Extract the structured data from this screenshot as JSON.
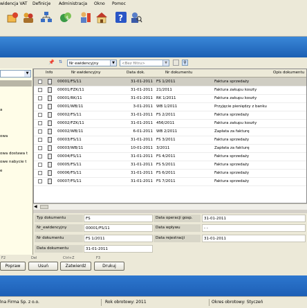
{
  "menu": {
    "items": [
      "widencja VAT",
      "Definicje",
      "Administracja",
      "Okno",
      "Pomoc"
    ]
  },
  "toolbar": {
    "icons": [
      "contractors-icon",
      "users-icon",
      "org-structure-icon",
      "currency-icon",
      "employee-icon",
      "house-icon",
      "help-icon",
      "search-person-icon"
    ]
  },
  "filter": {
    "sort_field": "Nr ewidencyjny",
    "filter_placeholder": "<Bez filtru>"
  },
  "left_panel": {
    "items": [
      "a",
      "owa",
      "owa dostawa t",
      "owe nabycie t",
      "e"
    ]
  },
  "grid": {
    "headers": {
      "info": "Info",
      "nr_ewid": "Nr ewidencyjny",
      "data_dok": "Data dok.",
      "nr_dok": "Nr dokumentu",
      "opis": "Opis dokumentu"
    },
    "rows": [
      {
        "nr_ewid": "00001/FS/11",
        "data_dok": "31-01-2011",
        "nr_dok": "FS 1/2011",
        "opis": "Faktura sprzedaży"
      },
      {
        "nr_ewid": "00001/FZK/11",
        "data_dok": "31-01-2011",
        "nr_dok": "21/2011",
        "opis": "Faktura zakupu koszty"
      },
      {
        "nr_ewid": "00001/RK/11",
        "data_dok": "31-01-2011",
        "nr_dok": "RK 1/2011",
        "opis": "Faktura zakupu koszty"
      },
      {
        "nr_ewid": "00001/WB/11",
        "data_dok": "3-01-2011",
        "nr_dok": "WB 1/2011",
        "opis": "Przyjęcie pieniędzy z banku"
      },
      {
        "nr_ewid": "00002/FS/11",
        "data_dok": "31-01-2011",
        "nr_dok": "FS 2/2011",
        "opis": "Faktura sprzedaży"
      },
      {
        "nr_ewid": "00002/FZK/11",
        "data_dok": "31-01-2011",
        "nr_dok": "456/2011",
        "opis": "Faktura zakupu koszty"
      },
      {
        "nr_ewid": "00002/WB/11",
        "data_dok": "6-01-2011",
        "nr_dok": "WB 2/2011",
        "opis": "Zapłata za fakturę"
      },
      {
        "nr_ewid": "00003/FS/11",
        "data_dok": "31-01-2011",
        "nr_dok": "FS 3/2011",
        "opis": "Faktura sprzedaży"
      },
      {
        "nr_ewid": "00003/WB/11",
        "data_dok": "10-01-2011",
        "nr_dok": "3/2011",
        "opis": "Zapłata za fakturę"
      },
      {
        "nr_ewid": "00004/FS/11",
        "data_dok": "31-01-2011",
        "nr_dok": "FS 4/2011",
        "opis": "Faktura sprzedaży"
      },
      {
        "nr_ewid": "00005/FS/11",
        "data_dok": "31-01-2011",
        "nr_dok": "FS 5/2011",
        "opis": "Faktura sprzedaży"
      },
      {
        "nr_ewid": "00006/FS/11",
        "data_dok": "31-01-2011",
        "nr_dok": "FS 6/2011",
        "opis": "Faktura sprzedaży"
      },
      {
        "nr_ewid": "00007/FS/11",
        "data_dok": "31-01-2011",
        "nr_dok": "FS 7/2011",
        "opis": "Faktura sprzedaży"
      }
    ]
  },
  "detail": {
    "typ_label": "Typ dokumentu",
    "typ_value": "FS",
    "nr_ewid_label": "Nr_ewidencyjny",
    "nr_ewid_value": "00001/FS/11",
    "nr_dok_label": "Nr dokumentu",
    "nr_dok_value": "FS 1/2011",
    "data_dok_label": "Data dokumentu",
    "data_dok_value": "31-01-2011",
    "data_oper_label": "Data operacji gosp.",
    "data_oper_value": "31-01-2011",
    "data_wplywu_label": "Data wpływu",
    "data_wplywu_value": "- -",
    "data_rej_label": "Data rejestracji",
    "data_rej_value": "31-01-2011"
  },
  "buttons": {
    "shortcut_1": "F2",
    "shortcut_2": "Del",
    "shortcut_3": "Ctrl+Z",
    "shortcut_4": "F3",
    "popraw": "Popraw",
    "usun": "Usuń",
    "zatwierdz": "Zatwierdź",
    "drukuj": "Drukuj"
  },
  "status": {
    "company": "lna Firma Sp. z o.o.",
    "year": "Rok obrotowy: 2011",
    "period": "Okres obrotowy: Styczeń"
  }
}
